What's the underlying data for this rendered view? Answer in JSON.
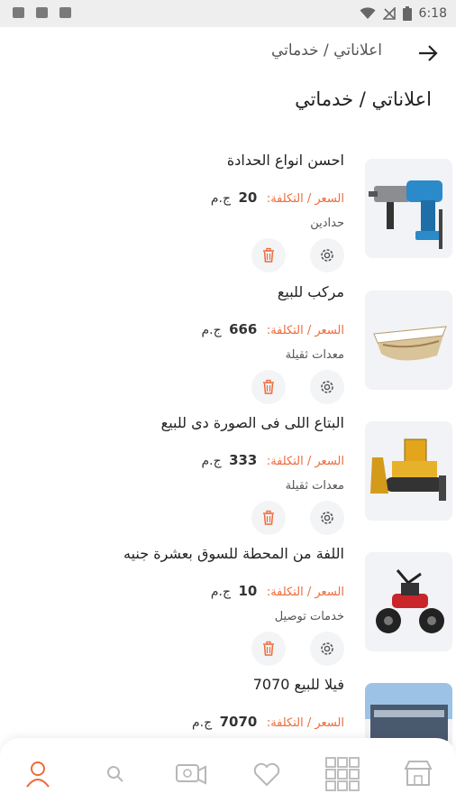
{
  "status_bar": {
    "time": "6:18"
  },
  "header": {
    "breadcrumb": "اعلاناتي / خدماتي",
    "page_title": "اعلاناتي / خدماتي"
  },
  "ads": [
    {
      "title": "احسن انواع الحدادة",
      "price_label": "السعر / التكلفة:",
      "price_value": "20",
      "currency": "ج.م",
      "category": "حدادين",
      "image": "drill-image"
    },
    {
      "title": "مركب للبيع",
      "price_label": "السعر / التكلفة:",
      "price_value": "666",
      "currency": "ج.م",
      "category": "معدات ثقيلة",
      "image": "boat-image"
    },
    {
      "title": "البتاع اللى فى الصورة دى للبيع",
      "price_label": "السعر / التكلفة:",
      "price_value": "333",
      "currency": "ج.م",
      "category": "معدات ثقيلة",
      "image": "bulldozer-image"
    },
    {
      "title": "اللفة من المحطة للسوق بعشرة جنيه",
      "price_label": "السعر / التكلفة:",
      "price_value": "10",
      "currency": "ج.م",
      "category": "خدمات توصيل",
      "image": "atv-image"
    },
    {
      "title": "فيلا للبيع 7070",
      "price_label": "السعر / التكلفة:",
      "price_value": "7070",
      "currency": "ج.م",
      "category": "",
      "image": "villa-image"
    }
  ],
  "bottom_nav": {
    "items": [
      "profile-icon",
      "search-icon",
      "sell-icon",
      "heart-icon",
      "grid-icon",
      "store-icon"
    ],
    "active": "profile-icon"
  },
  "colors": {
    "accent": "#ef6a3a",
    "icon_gray": "#b7b7b7",
    "title": "#222222"
  }
}
